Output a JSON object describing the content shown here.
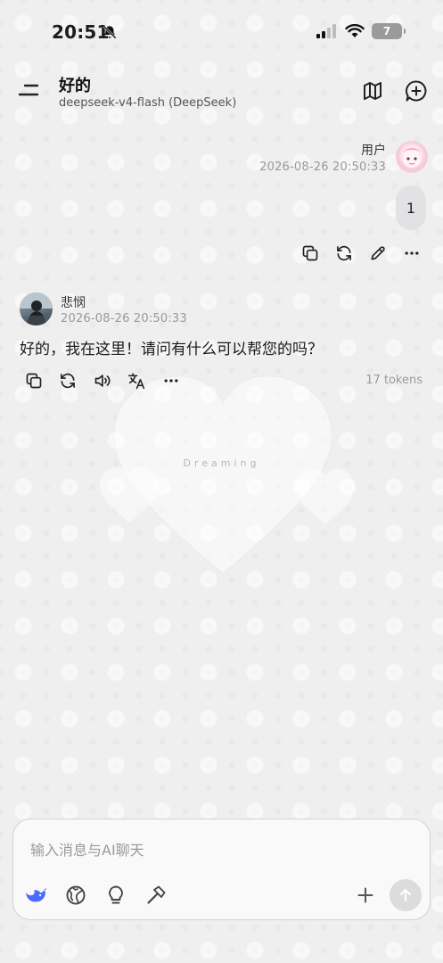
{
  "status_bar": {
    "time": "20:51",
    "battery_level": "7",
    "icons": [
      "bell-off-icon",
      "cellular-signal-icon",
      "wifi-icon",
      "battery-icon"
    ]
  },
  "header": {
    "title": "好的",
    "subtitle": "deepseek-v4-flash (DeepSeek)",
    "icons": [
      "menu-icon",
      "map-icon",
      "new-chat-icon"
    ]
  },
  "user_message": {
    "sender": "用户",
    "timestamp": "2026-08-26 20:50:33",
    "text": "1",
    "actions": [
      "copy-icon",
      "regenerate-icon",
      "edit-icon",
      "more-icon"
    ]
  },
  "assistant_message": {
    "sender": "悲悯",
    "timestamp": "2026-08-26 20:50:33",
    "text": "好的，我在这里！请问有什么可以帮您的吗？",
    "tokens": "17 tokens",
    "actions": [
      "copy-icon",
      "regenerate-icon",
      "speaker-icon",
      "translate-icon",
      "more-icon"
    ]
  },
  "watermark": {
    "text": "Dreaming"
  },
  "composer": {
    "placeholder": "输入消息与AI聊天",
    "tools": [
      "deepseek-logo-icon",
      "globe-icon",
      "lightbulb-icon",
      "hammer-icon",
      "plus-icon",
      "send-arrow-icon"
    ]
  },
  "colors": {
    "background": "#efefef",
    "bubble": "#e2e2e4",
    "accent_blue": "#4d6bfe",
    "muted_text": "#999999"
  }
}
